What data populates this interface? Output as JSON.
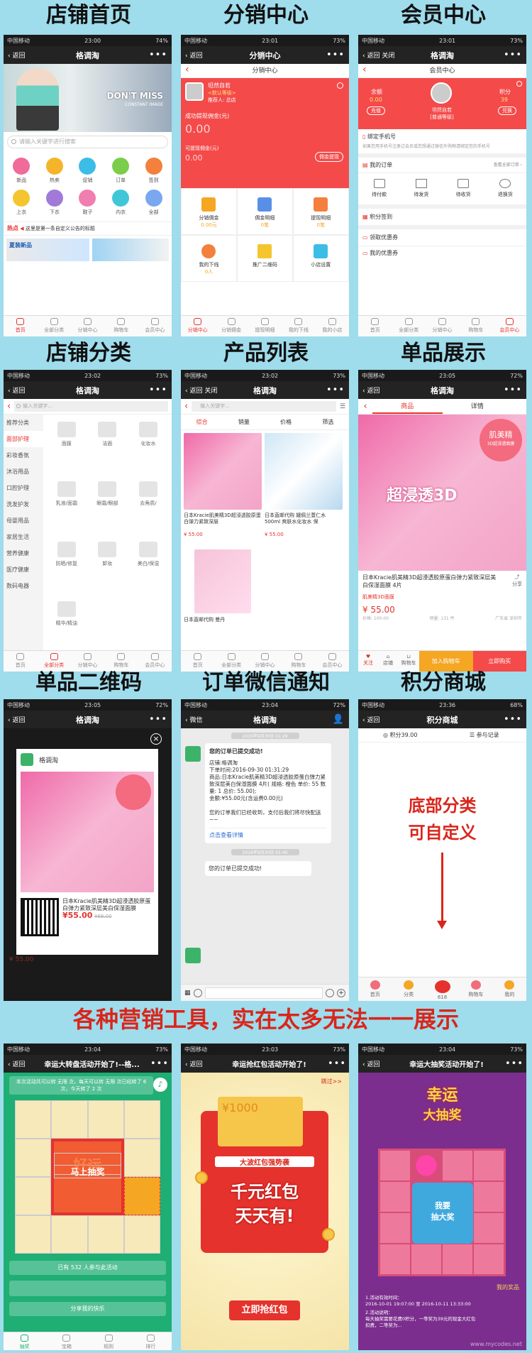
{
  "titles": [
    "店铺首页",
    "分销中心",
    "会员中心",
    "店铺分类",
    "产品列表",
    "单品展示",
    "单品二维码",
    "订单微信通知",
    "积分商城"
  ],
  "marketing_banner": "各种营销工具，实在太多无法一一展示",
  "status": {
    "carrier": "中国移动",
    "wifi": "令",
    "t1": "23:00",
    "t2": "23:01",
    "t3": "23:01",
    "t4": "23:02",
    "t5": "23:02",
    "t6": "23:05",
    "t7": "23:05",
    "t8": "23:04",
    "t9": "23:36",
    "t10": "23:04",
    "t11": "23:03",
    "t12": "23:04",
    "b1": "74%",
    "b2": "73%",
    "b3": "73%",
    "b4": "73%",
    "b5": "73%",
    "b6": "72%",
    "b7": "72%",
    "b8": "72%",
    "b9": "68%",
    "b10": "73%",
    "b11": "73%",
    "b12": "73%"
  },
  "nav": {
    "back": "返回",
    "close": "关闭",
    "shop": "格调淘",
    "more": "•••",
    "wechat": "微信"
  },
  "home": {
    "banner1": "DON'T MISS",
    "banner2": "CONSTANT IMAGE",
    "search": "请输入关键字进行搜索",
    "icons": [
      "新品",
      "热卖",
      "促销",
      "订单",
      "签到",
      "上衣",
      "下衣",
      "鞋子",
      "内衣",
      "全部"
    ],
    "notice_tag": "热点",
    "notice": "这里是第一条自定义公告的标题",
    "promo": "夏装新品",
    "tabs": [
      "首页",
      "全部分类",
      "分销中心",
      "购物车",
      "会员中心"
    ]
  },
  "dist": {
    "header": "分销中心",
    "name": "坦然自若",
    "level": "<默认等级>",
    "referrer": "推荐人: 总店",
    "earned_label": "成功提现佣金(元)",
    "earned": "0.00",
    "avail_label": "可提现佣金(元)",
    "avail": "0.00",
    "withdraw": "佣金提现",
    "cells": [
      {
        "t": "分销佣金",
        "s": "0.00元"
      },
      {
        "t": "佣金明细",
        "s": "0笔"
      },
      {
        "t": "提现明细",
        "s": "0笔"
      },
      {
        "t": "我的下线",
        "s": "0人"
      },
      {
        "t": "推广二维码",
        "s": ""
      },
      {
        "t": "小店设置",
        "s": ""
      }
    ],
    "tabs": [
      "分销中心",
      "分销佣金",
      "提现明细",
      "我的下线",
      "我的小店"
    ]
  },
  "member": {
    "header": "会员中心",
    "balance_label": "余额",
    "balance": "0.00",
    "points_label": "积分",
    "points": "39",
    "name": "坦然自若",
    "level": "[普通等级]",
    "recharge": "充值",
    "exchange": "兑换",
    "bind": "绑定手机号",
    "bind_note": "如果您用手机号注册过会员或您想通过微信外购物请绑定您的手机号",
    "orders": "我的订单",
    "all_orders": "查看全部订单 ›",
    "order_states": [
      "待付款",
      "待发货",
      "待收货",
      "退换货"
    ],
    "points_sign": "积分签到",
    "coupons": "领取优惠券",
    "my_coupons": "我的优惠券",
    "tabs": [
      "首页",
      "全部分类",
      "分销中心",
      "购物车",
      "会员中心"
    ]
  },
  "cat": {
    "search": "输入关键字...",
    "left": [
      "推荐分类",
      "面部护理",
      "彩妆香氛",
      "沐浴用品",
      "口腔护理",
      "洗发护发",
      "母婴用品",
      "家居生活",
      "营养健康",
      "医疗健康",
      "数码电器"
    ],
    "right": [
      "面膜",
      "洁面",
      "化妆水",
      "乳液/面霜",
      "眼霜/眼部",
      "去角质/",
      "防晒/修复",
      "卸妆",
      "美白/保湿",
      "精华/精油"
    ],
    "tabs": [
      "首页",
      "全部分类",
      "分销中心",
      "购物车",
      "会员中心"
    ]
  },
  "plist": {
    "search": "输入关键字...",
    "sort": [
      "综合",
      "销量",
      "价格",
      "筛选"
    ],
    "items": [
      {
        "name": "日本Kracie肌美精3D超浸透胶原蛋白弹力紧致深层",
        "price": "¥ 55.00"
      },
      {
        "name": "日本直邮代购 娥佩兰薏仁水 500ml 爽肤水化妆水 保",
        "price": "¥ 55.00"
      },
      {
        "name": "日本直邮代购 曼丹",
        "price": ""
      }
    ],
    "tabs": [
      "首页",
      "全部分类",
      "分销中心",
      "购物车",
      "会员中心"
    ]
  },
  "pdetail": {
    "tab1": "商品",
    "tab2": "详情",
    "badge": "肌美精",
    "badge2": "3D超浸透面膜",
    "product_text": "超浸透3D",
    "name": "日本Kracie肌美精3D超浸透胶原蛋白弹力紧致深层美白保湿面膜 4片",
    "brand": "肌美精3D面膜",
    "price": "¥ 55.00",
    "share": "分享",
    "orig": "价格: 100.00",
    "sales": "销量: 131 件",
    "origin": "广东省 深圳市",
    "fav": "关注",
    "shop": "店铺",
    "cart": "购物车",
    "add": "加入购物车",
    "buy": "立即购买"
  },
  "qr": {
    "shop": "格调淘",
    "name": "日本Kracie肌美精3D超浸透胶原蛋白弹力紧致深层美白保湿面膜",
    "price": "¥55.00",
    "orig": "¥68.00",
    "close": "×",
    "bg_price": "¥ 55.00"
  },
  "wx": {
    "time1": "2016年9月30日 01:29",
    "time2": "2016年9月30日 01:40",
    "msg_title": "您的订单已提交成功!",
    "body": "店铺:格调淘\n下单时间:2016-09-30 01:31:29\n商品:日本Kracie肌美精3D超浸透胶原蛋白弹力紧致深层美白保湿面膜 4片( 规格: 橙色 单价: 55 数量: 1 总价: 55.00);\n金额:¥55.00元(含运费0.00元)\n\n您的订单我们已经收到，支付后我们将尽快配送~~",
    "link": "点击查看详情",
    "msg2": "您的订单已提交成功!"
  },
  "mall": {
    "header": "积分商城",
    "points": "积分39.00",
    "record": "参与记录",
    "line1": "底部分类",
    "line2": "可自定义",
    "tabs": [
      "首页",
      "分类",
      "618",
      "购物车",
      "我的"
    ]
  },
  "wheel": {
    "title": "幸运大转盘活动开始了!--格...",
    "info": "本次活动共可以转 无限 次，每天可以转 无限 次已经转了 6 次，今天转了 2 次",
    "btn": "马上抽奖",
    "bg": "好运",
    "count": "已有 532 人参与此活动",
    "share": "分享我的快乐",
    "tabs": [
      "抽奖",
      "宝箱",
      "规则",
      "排行"
    ]
  },
  "redpack": {
    "title": "幸运抢红包活动开始了!",
    "skip": "跳过>>",
    "amount": "¥1000",
    "tag": "大波红包强势袭",
    "big1": "千元红包",
    "big2": "天天有!",
    "btn": "立即抢红包"
  },
  "lottery": {
    "title": "幸运大抽奖活动开始了!",
    "brand1": "幸运",
    "brand2": "大抽奖",
    "center1": "我要",
    "center2": "抽大奖",
    "prize": "我的奖品",
    "rules_title": "1.活动有效时间：",
    "rules_time": "2016-10-01 19:07:00 至 2016-10-11 13:33:00",
    "rules2": "2.活动说明：",
    "rules3": "每天抽奖需要花费0积分，一等奖为39元的现金大红包",
    "rules4": "扣费，二等奖为...",
    "watermark": "www.mycodes.net"
  },
  "colors": {
    "accent": "#e5322d",
    "bg": "#9fdcec",
    "wheel_green": "#1fae74",
    "lottery_purple": "#7b2e8e"
  }
}
